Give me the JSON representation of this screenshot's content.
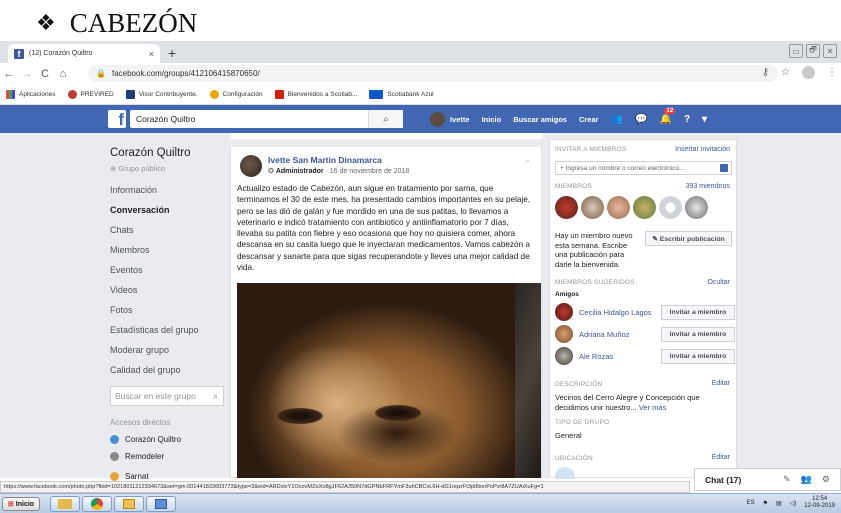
{
  "doc_heading": {
    "bullet": "❖",
    "text": "CABEZÓN"
  },
  "browser": {
    "tab_title": "(12) Corazón Quiltro",
    "tab_close": "×",
    "new_tab": "+",
    "url": "facebook.com/groups/412106415870650/",
    "bookmarks": [
      "Aplicaciones",
      "PREVIRED",
      "Visor Contribuyente.",
      "Configuración",
      "Bienvenidos a Scotiab...",
      "Scotiabank Azul"
    ],
    "status_url": "https://www.facebook.com/photo.php?fbid=10218011212334673&set=gm.601441833603773&type=3&eid=ARDslvY1OcovMZoXo8gJF62A350N7dGPNbFRFYmF3uhCBCvL6H-dG1oqzrFt3pt8ionPoPvr8A7ZUAiXuFg=1",
    "win_controls": [
      "▭",
      "🗗",
      "✕"
    ]
  },
  "fb": {
    "search_value": "Corazón Quiltro",
    "nav": {
      "me": "Ivette",
      "home": "Inicio",
      "find_friends": "Buscar amigos",
      "create": "Crear"
    },
    "notification_badge": "12",
    "colors": {
      "header": "#4267b2",
      "link": "#385898",
      "background": "#e9ebee"
    }
  },
  "group": {
    "name": "Corazón Quiltro",
    "privacy": "Grupo público",
    "nav": [
      "Información",
      "Conversación",
      "Chats",
      "Miembros",
      "Eventos",
      "Videos",
      "Fotos",
      "Estadísticas del grupo",
      "Moderar grupo",
      "Calidad del grupo"
    ],
    "active_nav": "Conversación",
    "search_placeholder": "Buscar en este grupo",
    "shortcuts_heading": "Accesos directos",
    "shortcuts": [
      "Corazón Quiltro",
      "Remodeler",
      "Sarnat"
    ]
  },
  "post": {
    "author": "Ivette San Martin Dinamarca",
    "role": "Administrador",
    "date": "16 de noviembre de 2018",
    "text": "Actualizo estado de Cabezón, aun sigue en tratamiento por sarna, que terminamos el 30 de este mes, ha presentado cambios importantes en su pelaje, pero se las dió de galán y fue mordido en una de sus patitas, lo llevamos a veterinario e indicó tratamiento con antibiotico y antiinflamatorio por 7 días, llevaba su patita con fiebre y eso ocasiona que hoy no quisiera comer, ahora descansa en su casita luego que le inyectaran medicamentos. Vamos cabezón a descansar y sanarte para que sigas recuperandote y lleves una mejor calidad de vida."
  },
  "sidebar": {
    "invite_heading": "Invitar a miembros",
    "invite_link": "Insertar invitación",
    "invite_placeholder": "+ Ingresa un nombre o correo electrónico...",
    "members_heading": "Miembros",
    "members_count": "393 miembros",
    "new_member_text": "Hay un miembro nuevo esta semana. Escribe una publicación para darle la bienvenida.",
    "write_post_button": "✎ Escribir publicación",
    "suggested_heading": "Miembros sugeridos",
    "hide_link": "Ocultar",
    "friends_label": "Amigos",
    "suggested": [
      {
        "name": "Cecilia Hidalgo Lagos",
        "button": "Invitar a miembro"
      },
      {
        "name": "Adriana Muñoz",
        "button": "Invitar a miembro"
      },
      {
        "name": "Ale Rozas",
        "button": "Invitar a miembro"
      }
    ],
    "description_heading": "Descripción",
    "edit_link": "Editar",
    "description": "Vecinos del Cerro Alegre y Concepción que decidimos unir nuestro...",
    "see_more": "Ver más",
    "group_type_heading": "Tipo de grupo",
    "group_type": "General",
    "location_heading": "Ubicación",
    "location_edit": "Editar"
  },
  "chat": {
    "label": "Chat (17)"
  },
  "taskbar": {
    "start": "Inicio",
    "lang": "ES",
    "time": "12:54",
    "date": "12-09-2019"
  }
}
